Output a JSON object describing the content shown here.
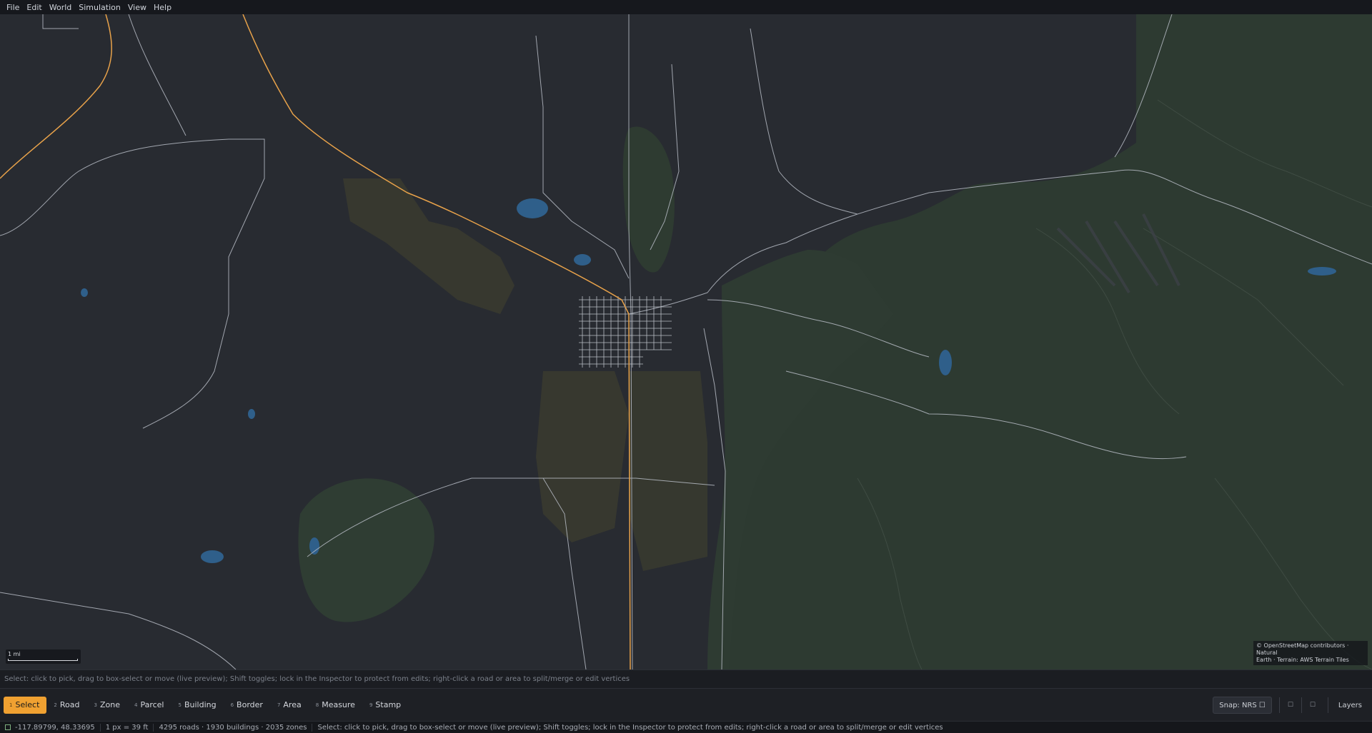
{
  "menu": [
    "File",
    "Edit",
    "World",
    "Simulation",
    "View",
    "Help"
  ],
  "map": {
    "scale_label": "1 mi",
    "attribution_line1": "© OpenStreetMap contributors · Natural",
    "attribution_line2": "Earth · Terrain: AWS Terrain Tiles",
    "colors": {
      "background": "#282b31",
      "forest": "#2f3d33",
      "agriculture": "#3a3a30",
      "water": "#2f5f8a",
      "road": "#b7bcc5",
      "highway": "#e8a24a"
    }
  },
  "hint": "Select: click to pick, drag to box-select or move (live preview); Shift toggles; lock in the Inspector to protect from edits; right-click a road or area to split/merge or edit vertices",
  "tools": [
    {
      "key": "1",
      "label": "Select",
      "active": true
    },
    {
      "key": "2",
      "label": "Road"
    },
    {
      "key": "3",
      "label": "Zone"
    },
    {
      "key": "4",
      "label": "Parcel"
    },
    {
      "key": "5",
      "label": "Building"
    },
    {
      "key": "6",
      "label": "Border"
    },
    {
      "key": "7",
      "label": "Area"
    },
    {
      "key": "8",
      "label": "Measure"
    },
    {
      "key": "9",
      "label": "Stamp"
    }
  ],
  "snap_label": "Snap: NRS ☐",
  "toggle1": "☐",
  "toggle2": "☐",
  "layers_label": "Layers",
  "status": {
    "coords": "-117.89799, 48.33695",
    "scale": "1 px = 39 ft",
    "counts": "4295 roads · 1930 buildings · 2035 zones",
    "message": "Select: click to pick, drag to box-select or move (live preview); Shift toggles; lock in the Inspector to protect from edits; right-click a road or area to split/merge or edit vertices"
  }
}
